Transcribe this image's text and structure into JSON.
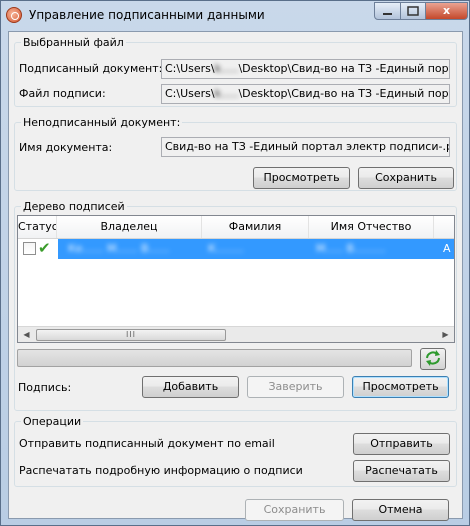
{
  "window": {
    "title": "Управление подписанными данными",
    "close_glyph": "x"
  },
  "selected_file": {
    "legend": "Выбранный файл",
    "signed_doc_label": "Подписанный документ:",
    "signed_doc_value": "C:\\Users\\",
    "signed_doc_value_tail": "\\Desktop\\Свид-во на ТЗ -Единый порт",
    "signature_file_label": "Файл подписи:",
    "signature_file_value": "C:\\Users\\",
    "signature_file_value_tail": "\\Desktop\\Свид-во на ТЗ -Единый порт"
  },
  "unsigned_doc": {
    "legend": "Неподписанный документ:",
    "name_label": "Имя документа:",
    "name_value": "Свид-во на ТЗ -Единый портал электр подписи-.pdf",
    "view_button": "Просмотреть",
    "save_button": "Сохранить"
  },
  "signature_tree": {
    "legend": "Дерево подписей",
    "columns": [
      "Статус",
      "Владелец",
      "Фамилия",
      "Имя Отчество"
    ],
    "rows": [
      {
        "owner": "Ке...... М...... В......",
        "last_name": "К........",
        "first_name": "М..... В.........",
        "extra": "А"
      }
    ],
    "signature_label": "Подпись:",
    "add_button": "Добавить",
    "certify_button": "Заверить",
    "view_button": "Просмотреть"
  },
  "operations": {
    "legend": "Операции",
    "email_label": "Отправить подписанный документ по email",
    "send_button": "Отправить",
    "print_label": "Распечатать подробную информацию о подписи",
    "print_button": "Распечатать"
  },
  "footer": {
    "save_button": "Сохранить",
    "cancel_button": "Отмена"
  },
  "icons": {
    "app": "app-seal-icon",
    "status_ok": "check-icon",
    "refresh": "refresh-icon"
  },
  "colors": {
    "selection": "#3399ff",
    "check": "#3a9c2b"
  }
}
